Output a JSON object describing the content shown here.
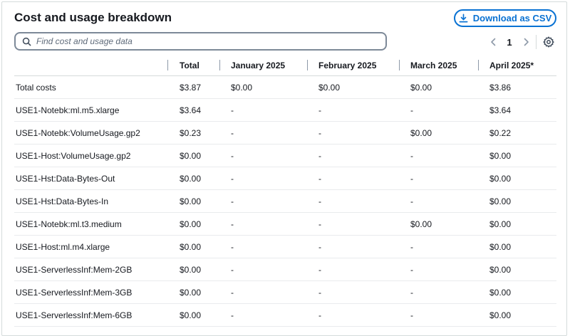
{
  "header": {
    "title": "Cost and usage breakdown",
    "download_label": "Download as CSV"
  },
  "search": {
    "placeholder": "Find cost and usage data",
    "value": ""
  },
  "pagination": {
    "current_page": "1"
  },
  "icons": {
    "download": "download-icon",
    "search": "search-icon",
    "prev": "chevron-left-icon",
    "next": "chevron-right-icon",
    "settings": "gear-icon"
  },
  "colors": {
    "accent": "#0972d3",
    "border": "#7d8998",
    "text": "#16191f"
  },
  "table": {
    "columns": [
      "",
      "Total",
      "January 2025",
      "February 2025",
      "March 2025",
      "April 2025*"
    ],
    "rows": [
      [
        "Total costs",
        "$3.87",
        "$0.00",
        "$0.00",
        "$0.00",
        "$3.86"
      ],
      [
        "USE1-Notebk:ml.m5.xlarge",
        "$3.64",
        "-",
        "-",
        "-",
        "$3.64"
      ],
      [
        "USE1-Notebk:VolumeUsage.gp2",
        "$0.23",
        "-",
        "-",
        "$0.00",
        "$0.22"
      ],
      [
        "USE1-Host:VolumeUsage.gp2",
        "$0.00",
        "-",
        "-",
        "-",
        "$0.00"
      ],
      [
        "USE1-Hst:Data-Bytes-Out",
        "$0.00",
        "-",
        "-",
        "-",
        "$0.00"
      ],
      [
        "USE1-Hst:Data-Bytes-In",
        "$0.00",
        "-",
        "-",
        "-",
        "$0.00"
      ],
      [
        "USE1-Notebk:ml.t3.medium",
        "$0.00",
        "-",
        "-",
        "$0.00",
        "$0.00"
      ],
      [
        "USE1-Host:ml.m4.xlarge",
        "$0.00",
        "-",
        "-",
        "-",
        "$0.00"
      ],
      [
        "USE1-ServerlessInf:Mem-2GB",
        "$0.00",
        "-",
        "-",
        "-",
        "$0.00"
      ],
      [
        "USE1-ServerlessInf:Mem-3GB",
        "$0.00",
        "-",
        "-",
        "-",
        "$0.00"
      ],
      [
        "USE1-ServerlessInf:Mem-6GB",
        "$0.00",
        "-",
        "-",
        "-",
        "$0.00"
      ]
    ]
  }
}
